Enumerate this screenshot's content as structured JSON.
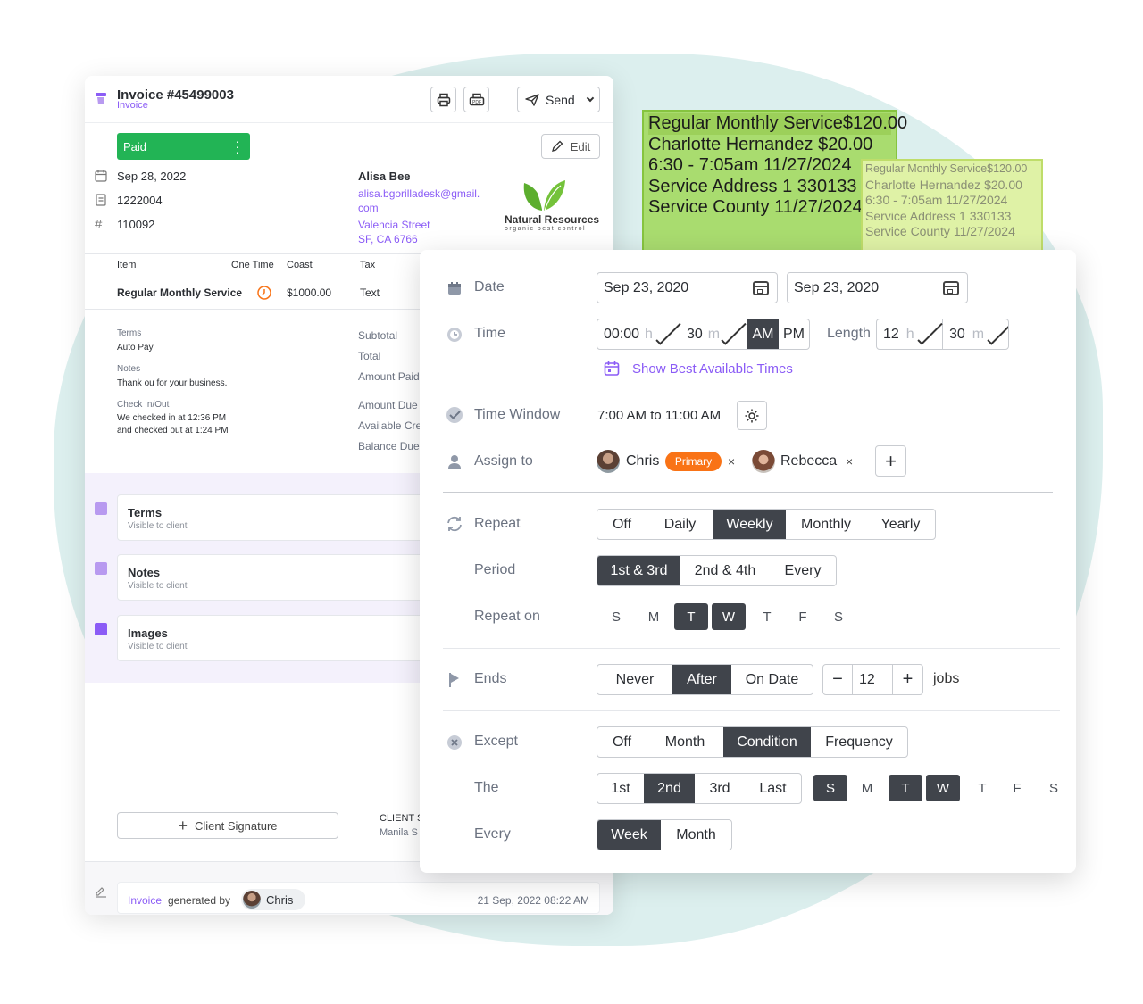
{
  "invoice": {
    "title": "Invoice #45499003",
    "subtitle": "Invoice",
    "send_label": "Send",
    "status": "Paid",
    "edit_label": "Edit",
    "date": "Sep 28, 2022",
    "number1": "1222004",
    "number2": "110092",
    "client_name": "Alisa Bee",
    "client_email_1": "alisa.bgorilladesk@gmail.",
    "client_email_2": "com",
    "address_1": "Valencia Street",
    "address_2": "SF, CA 6766",
    "logo_name": "Natural Resources",
    "logo_tagline": "organic pest control",
    "table_headers": [
      "Item",
      "One Time",
      "Coast",
      "Tax"
    ],
    "row": {
      "item": "Regular Monthly Service",
      "coast": "$1000.00",
      "tax": "Text"
    },
    "terms_label": "Terms",
    "terms_value": "Auto Pay",
    "notes_label": "Notes",
    "notes_value": "Thank ou for your business.",
    "check_label": "Check In/Out",
    "check_value_1": "We checked in at 12:36 PM",
    "check_value_2": "and checked out at 1:24 PM",
    "totals": [
      "Subtotal",
      "Total",
      "Amount Paid",
      "Amount Due",
      "Available Cre",
      "Balance Due"
    ],
    "sections": [
      {
        "title": "Terms",
        "sub": "Visible to client"
      },
      {
        "title": "Notes",
        "sub": "Visible to client"
      },
      {
        "title": "Images",
        "sub": "Visible to client"
      }
    ],
    "signature_label": "Client Signature",
    "client_s_label": "CLIENT S",
    "client_s_value": "Manila S",
    "footer_invoice": "Invoice",
    "footer_generated": "generated by",
    "footer_user": "Chris",
    "footer_time": "21 Sep, 2022 08:22 AM"
  },
  "note1": {
    "lines": [
      "Regular Monthly Service$120.00",
      "Charlotte Hernandez  $20.00",
      "6:30 - 7:05am  11/27/2024",
      "Service Address 1  330133",
      "Service County  11/27/2024"
    ]
  },
  "note2": {
    "lines": [
      "Regular Monthly Service$120.00",
      "Charlotte Hernandez  $20.00",
      "6:30 - 7:05am  11/27/2024",
      "Service Address 1  330133",
      "Service County  11/27/2024"
    ]
  },
  "scheduler": {
    "date_label": "Date",
    "date_start": "Sep 23, 2020",
    "date_end": "Sep 23, 2020",
    "time_label": "Time",
    "time_hour": "00:00",
    "time_hour_unit": "h",
    "time_min": "30",
    "time_min_unit": "m",
    "am": "AM",
    "pm": "PM",
    "length_label": "Length",
    "length_hour": "12",
    "length_hour_unit": "h",
    "length_min": "30",
    "length_min_unit": "m",
    "best_times": "Show Best Available Times",
    "window_label": "Time Window",
    "window_value": "7:00 AM to 11:00 AM",
    "assign_label": "Assign to",
    "assignee1": "Chris",
    "primary_badge": "Primary",
    "assignee2": "Rebecca",
    "repeat_label": "Repeat",
    "repeat_options": [
      "Off",
      "Daily",
      "Weekly",
      "Monthly",
      "Yearly"
    ],
    "period_label": "Period",
    "period_options": [
      "1st & 3rd",
      "2nd & 4th",
      "Every"
    ],
    "repeat_on_label": "Repeat on",
    "weekdays": [
      "S",
      "M",
      "T",
      "W",
      "T",
      "F",
      "S"
    ],
    "ends_label": "Ends",
    "ends_options": [
      "Never",
      "After",
      "On Date"
    ],
    "ends_count": "12",
    "jobs_label": "jobs",
    "except_label": "Except",
    "except_options": [
      "Off",
      "Month",
      "Condition",
      "Frequency"
    ],
    "the_label": "The",
    "the_options": [
      "1st",
      "2nd",
      "3rd",
      "Last"
    ],
    "every_label": "Every",
    "every_options": [
      "Week",
      "Month"
    ],
    "colors": {
      "dark_selected": "#40444b",
      "primary_badge": "#f97316",
      "accent": "#8b5cf6",
      "paid": "#22b455"
    }
  }
}
